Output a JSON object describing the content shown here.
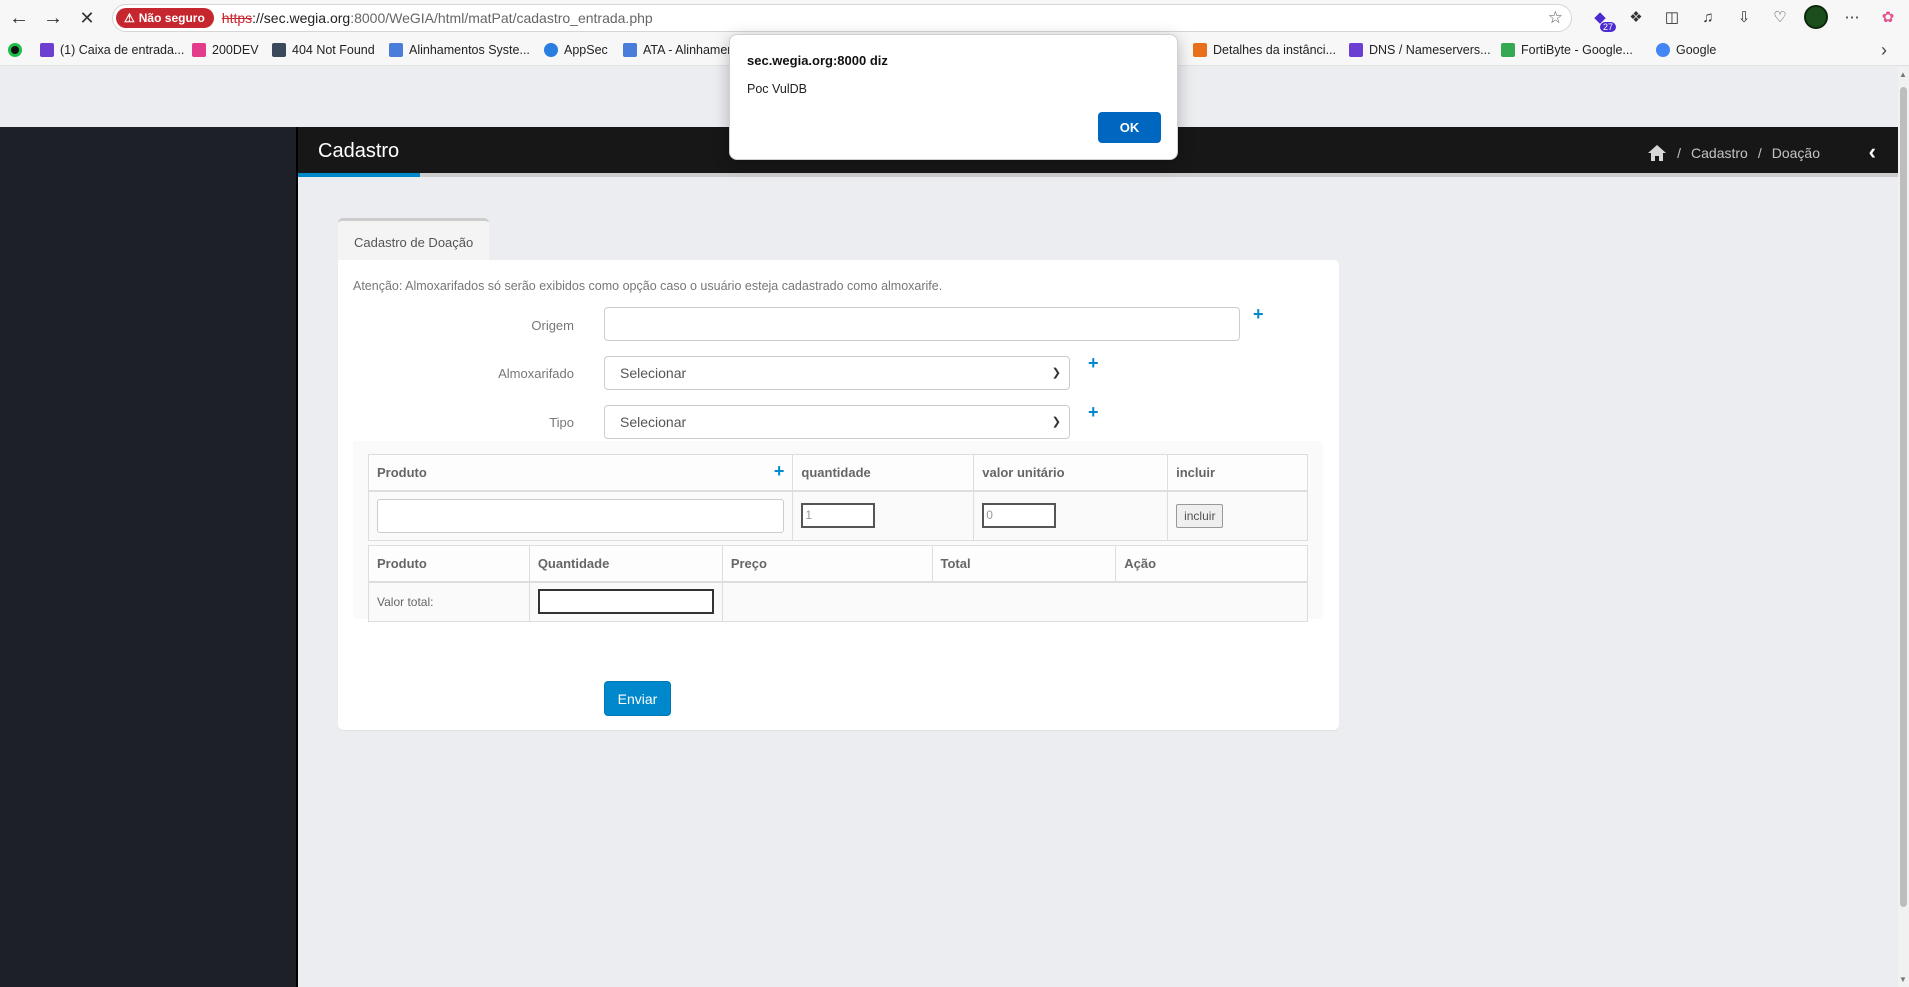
{
  "browser": {
    "security_label": "Não seguro",
    "url_scheme": "https",
    "url_host": "://sec.wegia.org",
    "url_rest": ":8000/WeGIA/html/matPat/cadastro_entrada.php",
    "extension_badge": "27",
    "bookmarks": [
      {
        "label": "(1) Caixa de entrada...",
        "color": "#6c3fd1"
      },
      {
        "label": "200DEV",
        "color": "#e23c8a"
      },
      {
        "label": "404 Not Found",
        "color": "#3b4a5a"
      },
      {
        "label": "Alinhamentos Syste...",
        "color": "#4a7dd9"
      },
      {
        "label": "AppSec",
        "color": "#2a7de1"
      },
      {
        "label": "ATA - Alinhamer",
        "color": "#4a7dd9"
      },
      {
        "label": "Detalhes da instânci...",
        "color": "#e8701a"
      },
      {
        "label": "DNS / Nameservers...",
        "color": "#6a3fd1"
      },
      {
        "label": "FortiByte - Google...",
        "color": "#34a853"
      },
      {
        "label": "Google",
        "color": "#4285f4"
      }
    ]
  },
  "header": {
    "title": "Cadastro",
    "breadcrumbs": [
      "Cadastro",
      "Doação"
    ]
  },
  "form": {
    "tab": "Cadastro de Doação",
    "notice": "Atenção: Almoxarifados só serão exibidos como opção caso o usuário esteja cadastrado como almoxarife.",
    "origem_label": "Origem",
    "almoxarifado_label": "Almoxarifado",
    "almoxarifado_value": "Selecionar",
    "tipo_label": "Tipo",
    "tipo_value": "Selecionar",
    "item_table": {
      "headers": [
        "Produto",
        "quantidade",
        "valor unitário",
        "incluir"
      ],
      "quantidade_value": "1",
      "valor_value": "0",
      "incluir_button": "incluir"
    },
    "summary_table": {
      "headers": [
        "Produto",
        "Quantidade",
        "Preço",
        "Total",
        "Ação"
      ],
      "total_label": "Valor total:"
    },
    "submit_label": "Enviar"
  },
  "dialog": {
    "title": "sec.wegia.org:8000 diz",
    "message": "Poc VulDB",
    "ok_label": "OK"
  },
  "colors": {
    "primary": "#0088cc",
    "sidebar": "#1d2127",
    "header": "#171717",
    "dialog_button": "#0067c0",
    "insecure": "#c6262e"
  }
}
